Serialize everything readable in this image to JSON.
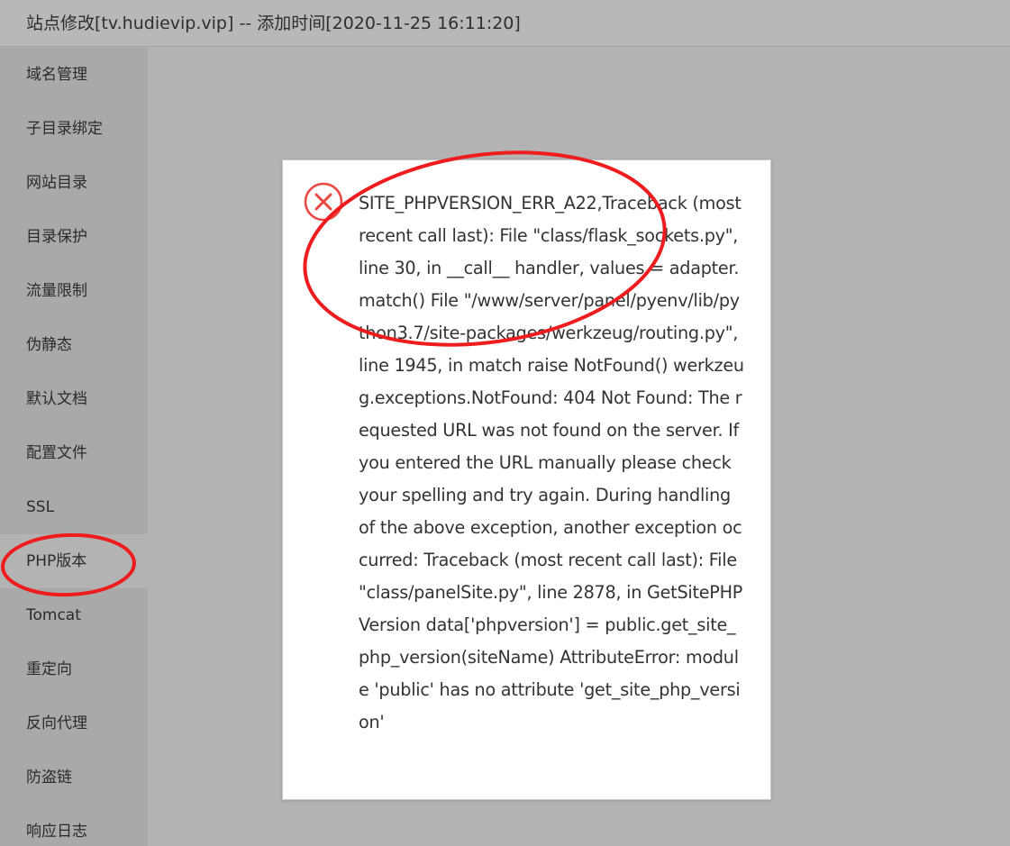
{
  "window": {
    "title": "站点修改[tv.hudievip.vip] -- 添加时间[2020-11-25 16:11:20]"
  },
  "sidebar": {
    "items": [
      {
        "label": "域名管理",
        "id": "domain"
      },
      {
        "label": "子目录绑定",
        "id": "subdir-bind"
      },
      {
        "label": "网站目录",
        "id": "site-dir"
      },
      {
        "label": "目录保护",
        "id": "dir-protect"
      },
      {
        "label": "流量限制",
        "id": "traffic-limit"
      },
      {
        "label": "伪静态",
        "id": "rewrite"
      },
      {
        "label": "默认文档",
        "id": "default-doc"
      },
      {
        "label": "配置文件",
        "id": "config-file"
      },
      {
        "label": "SSL",
        "id": "ssl"
      },
      {
        "label": "PHP版本",
        "id": "php-version"
      },
      {
        "label": "Tomcat",
        "id": "tomcat"
      },
      {
        "label": "重定向",
        "id": "redirect"
      },
      {
        "label": "反向代理",
        "id": "reverse-proxy"
      },
      {
        "label": "防盗链",
        "id": "hotlink"
      },
      {
        "label": "响应日志",
        "id": "response-log"
      }
    ],
    "active_index": 9
  },
  "dialog": {
    "icon": "error-circle-x-icon",
    "message": "SITE_PHPVERSION_ERR_A22,Traceback (most recent call last): File \"class/flask_sockets.py\", line 30, in __call__ handler, values = adapter.match() File \"/www/server/panel/pyenv/lib/python3.7/site-packages/werkzeug/routing.py\", line 1945, in match raise NotFound() werkzeug.exceptions.NotFound: 404 Not Found: The requested URL was not found on the server. If you entered the URL manually please check your spelling and try again. During handling of the above exception, another exception occurred: Traceback (most recent call last): File \"class/panelSite.py\", line 2878, in GetSitePHPVersion data['phpversion'] = public.get_site_php_version(siteName) AttributeError: module 'public' has no attribute 'get_site_php_version'"
  },
  "colors": {
    "overlay": "#b3b3b3",
    "sidebar": "#a9a9a9",
    "dialog_bg": "#ffffff",
    "text": "#333333",
    "error_red": "#e8483f",
    "annotation_red": "#ee1c1c"
  }
}
